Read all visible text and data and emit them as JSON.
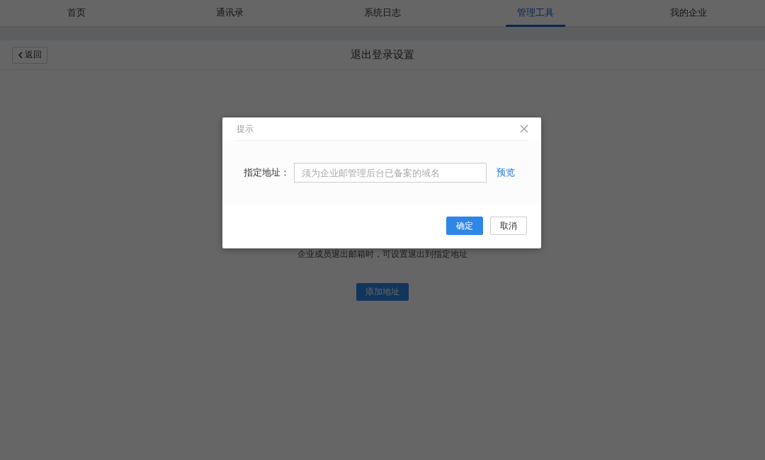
{
  "nav": {
    "tabs": [
      {
        "label": "首页",
        "selected": false
      },
      {
        "label": "通讯录",
        "selected": false
      },
      {
        "label": "系统日志",
        "selected": false
      },
      {
        "label": "管理工具",
        "selected": true
      },
      {
        "label": "我的企业",
        "selected": false
      }
    ]
  },
  "header": {
    "back": "返回",
    "title": "退出登录设置"
  },
  "content": {
    "description": "企业成员退出邮箱时，可设置退出到指定地址",
    "add_button": "添加地址"
  },
  "dialog": {
    "title": "提示",
    "field_label": "指定地址：",
    "placeholder": "须为企业邮管理后台已备案的域名",
    "preview_link": "预览",
    "confirm": "确定",
    "cancel": "取消"
  }
}
